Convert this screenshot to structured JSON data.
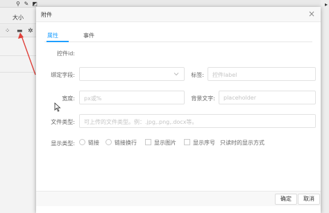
{
  "background": {
    "font_size_label": "大小"
  },
  "dialog": {
    "title": "附件",
    "close_glyph": "×"
  },
  "tabs": [
    {
      "label": "属性"
    },
    {
      "label": "事件"
    }
  ],
  "form": {
    "control_id_label": "控件id:",
    "bind_field_label": "绑定字段:",
    "tag_label": "标签:",
    "tag_placeholder": "控件label",
    "width_label": "宽度:",
    "width_placeholder": "px或%",
    "bg_text_label": "背景文字:",
    "bg_text_placeholder": "placeholder",
    "file_type_label": "文件类型:",
    "file_type_placeholder": "可上传的文件类型。例：.jpg,.png,.docx等。",
    "display_type_label": "显示类型:",
    "options": {
      "link": "链接",
      "link_wrap": "链接换行",
      "show_image": "显示图片",
      "show_index": "显示序号",
      "readonly_note": "只读时的显示方式"
    }
  },
  "footer": {
    "confirm": "确定",
    "cancel": "取消"
  },
  "colors": {
    "accent": "#1e9fff",
    "arrow": "#e0403a"
  }
}
